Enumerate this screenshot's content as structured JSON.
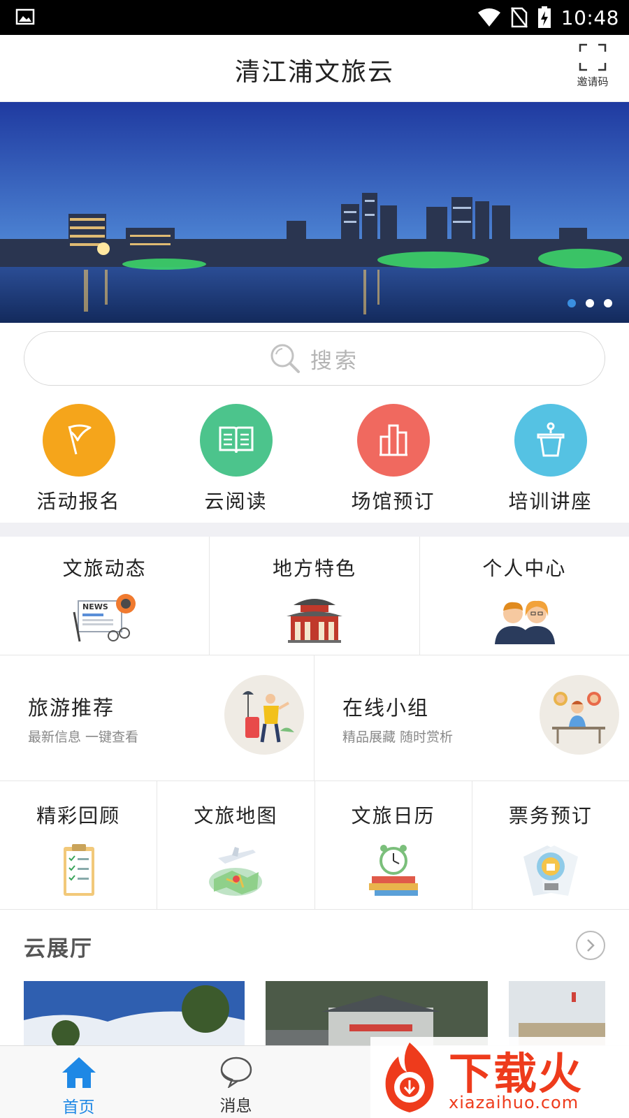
{
  "status_bar": {
    "time": "10:48"
  },
  "header": {
    "title": "清江浦文旅云",
    "invite_label": "邀请码"
  },
  "banner": {
    "slide_count": 3,
    "active_slide": 1
  },
  "search": {
    "placeholder": "搜索"
  },
  "quick_actions": [
    {
      "label": "活动报名",
      "icon": "flag-icon",
      "color": "#f5a51b"
    },
    {
      "label": "云阅读",
      "icon": "book-icon",
      "color": "#4cc48c"
    },
    {
      "label": "场馆预订",
      "icon": "building-icon",
      "color": "#f0695f"
    },
    {
      "label": "培训讲座",
      "icon": "podium-icon",
      "color": "#55c2e3"
    }
  ],
  "grid_row1": [
    {
      "label": "文旅动态",
      "icon": "news-icon"
    },
    {
      "label": "地方特色",
      "icon": "pavilion-icon"
    },
    {
      "label": "个人中心",
      "icon": "people-icon"
    }
  ],
  "grid_row2": [
    {
      "title": "旅游推荐",
      "subtitle": "最新信息 一键查看",
      "icon": "traveler-icon"
    },
    {
      "title": "在线小组",
      "subtitle": "精品展藏 随时赏析",
      "icon": "group-icon"
    }
  ],
  "grid_row3": [
    {
      "label": "精彩回顾",
      "icon": "clipboard-icon"
    },
    {
      "label": "文旅地图",
      "icon": "map-icon"
    },
    {
      "label": "文旅日历",
      "icon": "alarm-clock-icon"
    },
    {
      "label": "票务预订",
      "icon": "ticket-icon"
    }
  ],
  "hall": {
    "title": "云展厅"
  },
  "tabbar": [
    {
      "label": "首页",
      "icon": "home-icon",
      "active": true
    },
    {
      "label": "消息",
      "icon": "message-icon",
      "active": false
    }
  ],
  "watermark": {
    "brand": "下载火",
    "url": "xiazaihuo.com"
  }
}
